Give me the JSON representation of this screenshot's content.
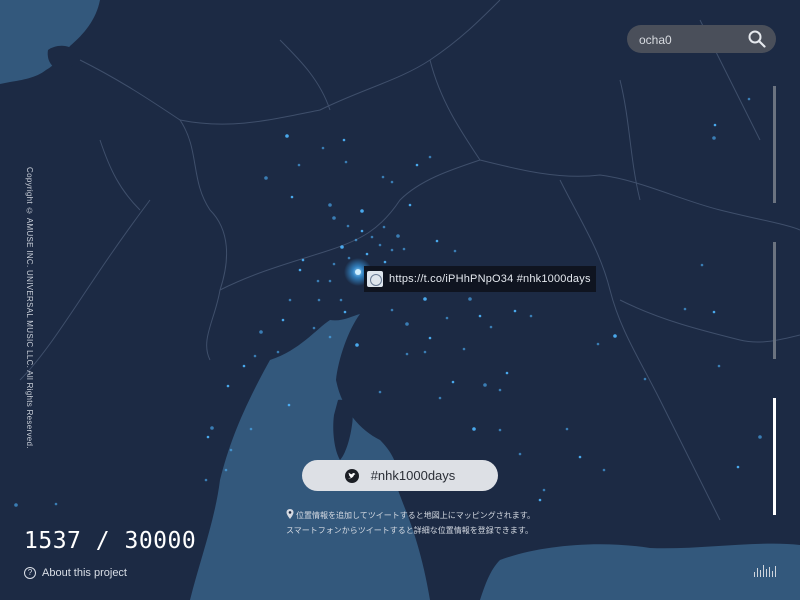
{
  "search": {
    "value": "ocha0",
    "icon": "search-icon"
  },
  "copyright": "Copyright © AMUSE INC. UNIVERSAL MUSIC LLC. All Rights Reserved.",
  "tweet_popup": {
    "text": "https://t.co/iPHhPNpO34 #nhk1000days"
  },
  "hashtag_button": {
    "label": "#nhk1000days",
    "icon": "twitter-icon"
  },
  "info_lines": [
    "位置情報を追加してツイートすると地図上にマッピングされます。",
    "スマートフォンからツイートすると詳細な位置情報を登録できます。"
  ],
  "counter": {
    "current": "1537",
    "separator": "/",
    "total": "30000"
  },
  "about_link": {
    "label": "About this project"
  },
  "colors": {
    "land": "#1c2a44",
    "sea": "#34597d",
    "dot": "#4fb6ff",
    "border": "#3d4c66"
  }
}
